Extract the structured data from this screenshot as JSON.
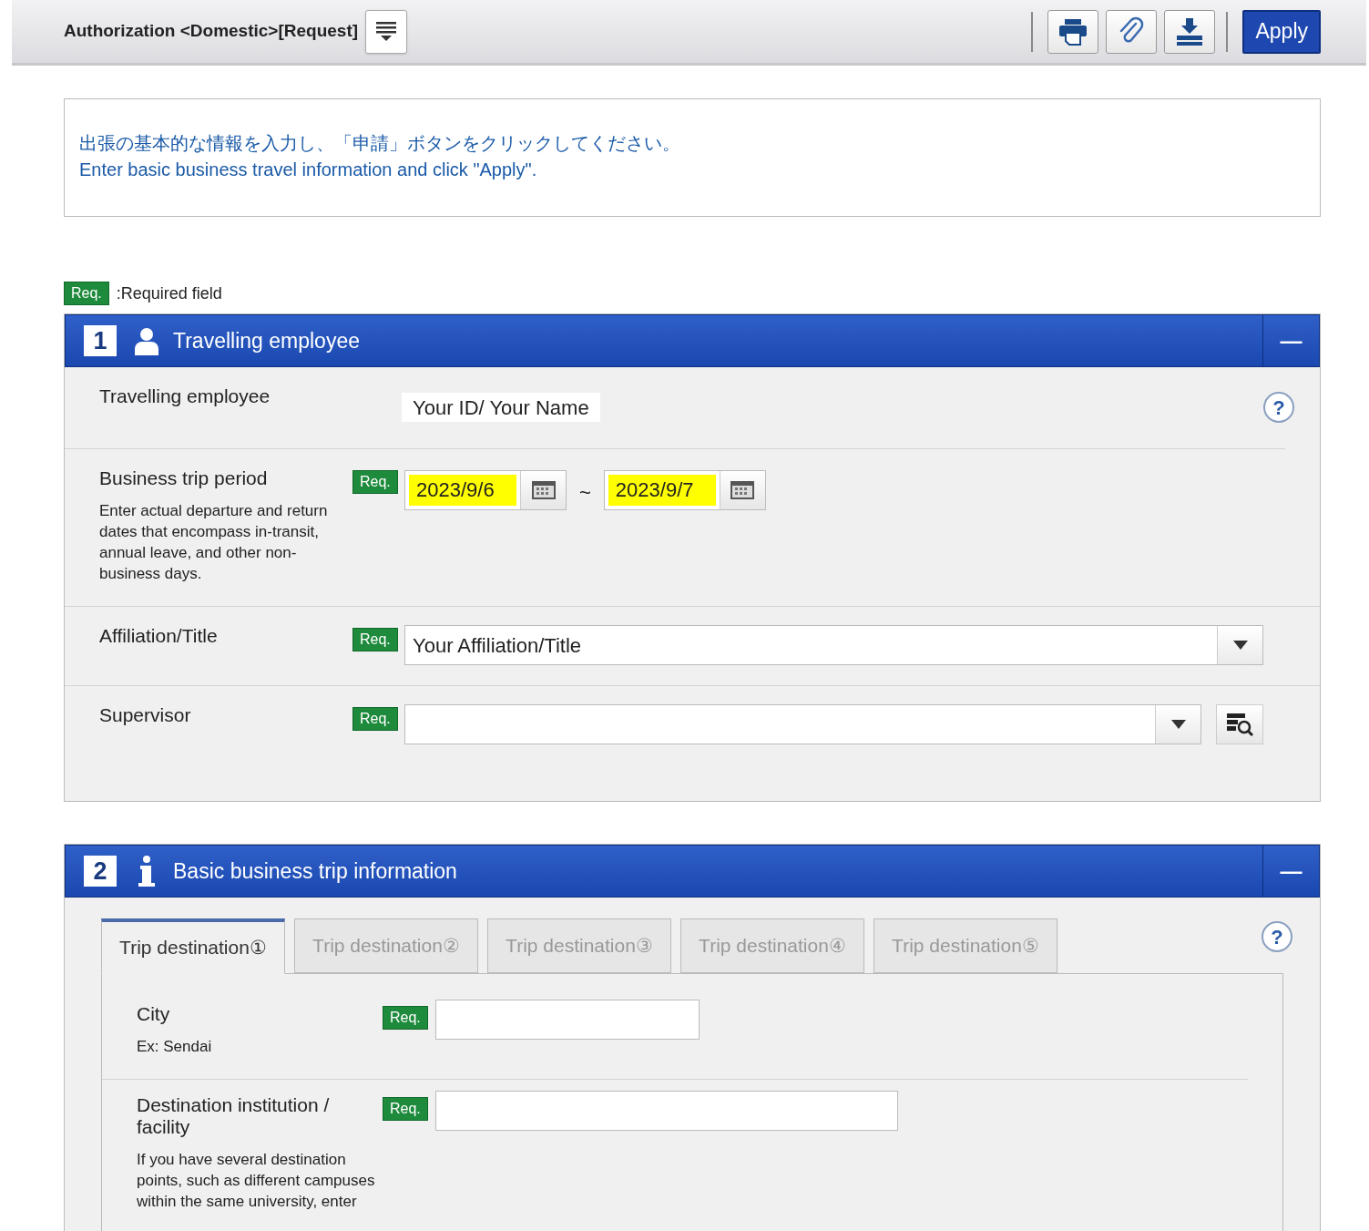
{
  "header": {
    "title": "Authorization <Domestic>[Request]",
    "apply_label": "Apply"
  },
  "notice": {
    "lines": [
      "出張の基本的な情報を入力し、「申請」ボタンをクリックしてください。",
      "Enter basic business travel information and click \"Apply\"."
    ]
  },
  "legend": {
    "badge": "Req.",
    "text": ":Required field"
  },
  "sections": [
    {
      "number": "1",
      "title": "Travelling employee",
      "collapse": "—",
      "help": "?",
      "fields": [
        {
          "kind": "display",
          "label": "Travelling employee",
          "value": "Your ID/ Your Name"
        },
        {
          "kind": "date_range",
          "label": "Business trip period",
          "badge": "Req.",
          "note": "Enter actual departure and return dates that encompass in-transit, annual leave, and other non-business days.",
          "from": {
            "value": "2023/9/6",
            "highlighted": true
          },
          "separator": "~",
          "to": {
            "value": "2023/9/7",
            "highlighted": true
          }
        },
        {
          "kind": "select",
          "label": "Affiliation/Title",
          "badge": "Req.",
          "value": "Your Affiliation/Title"
        },
        {
          "kind": "select_search",
          "label": "Supervisor",
          "badge": "Req."
        }
      ]
    },
    {
      "number": "2",
      "title": "Basic business trip information",
      "collapse": "—",
      "help": "?",
      "tabs": [
        {
          "label": "Trip destination①",
          "selected": true
        },
        {
          "label": "Trip destination②",
          "selected": false
        },
        {
          "label": "Trip destination③",
          "selected": false
        },
        {
          "label": "Trip destination④",
          "selected": false
        },
        {
          "label": "Trip destination⑤",
          "selected": false
        }
      ],
      "fields": [
        {
          "kind": "text",
          "label": "City",
          "badge": "Req.",
          "note": "Ex: Sendai"
        },
        {
          "kind": "text",
          "label": "Destination institution / facility",
          "badge": "Req.",
          "note": "If you have several destination points, such as different campuses within the same university, enter"
        }
      ]
    }
  ]
}
